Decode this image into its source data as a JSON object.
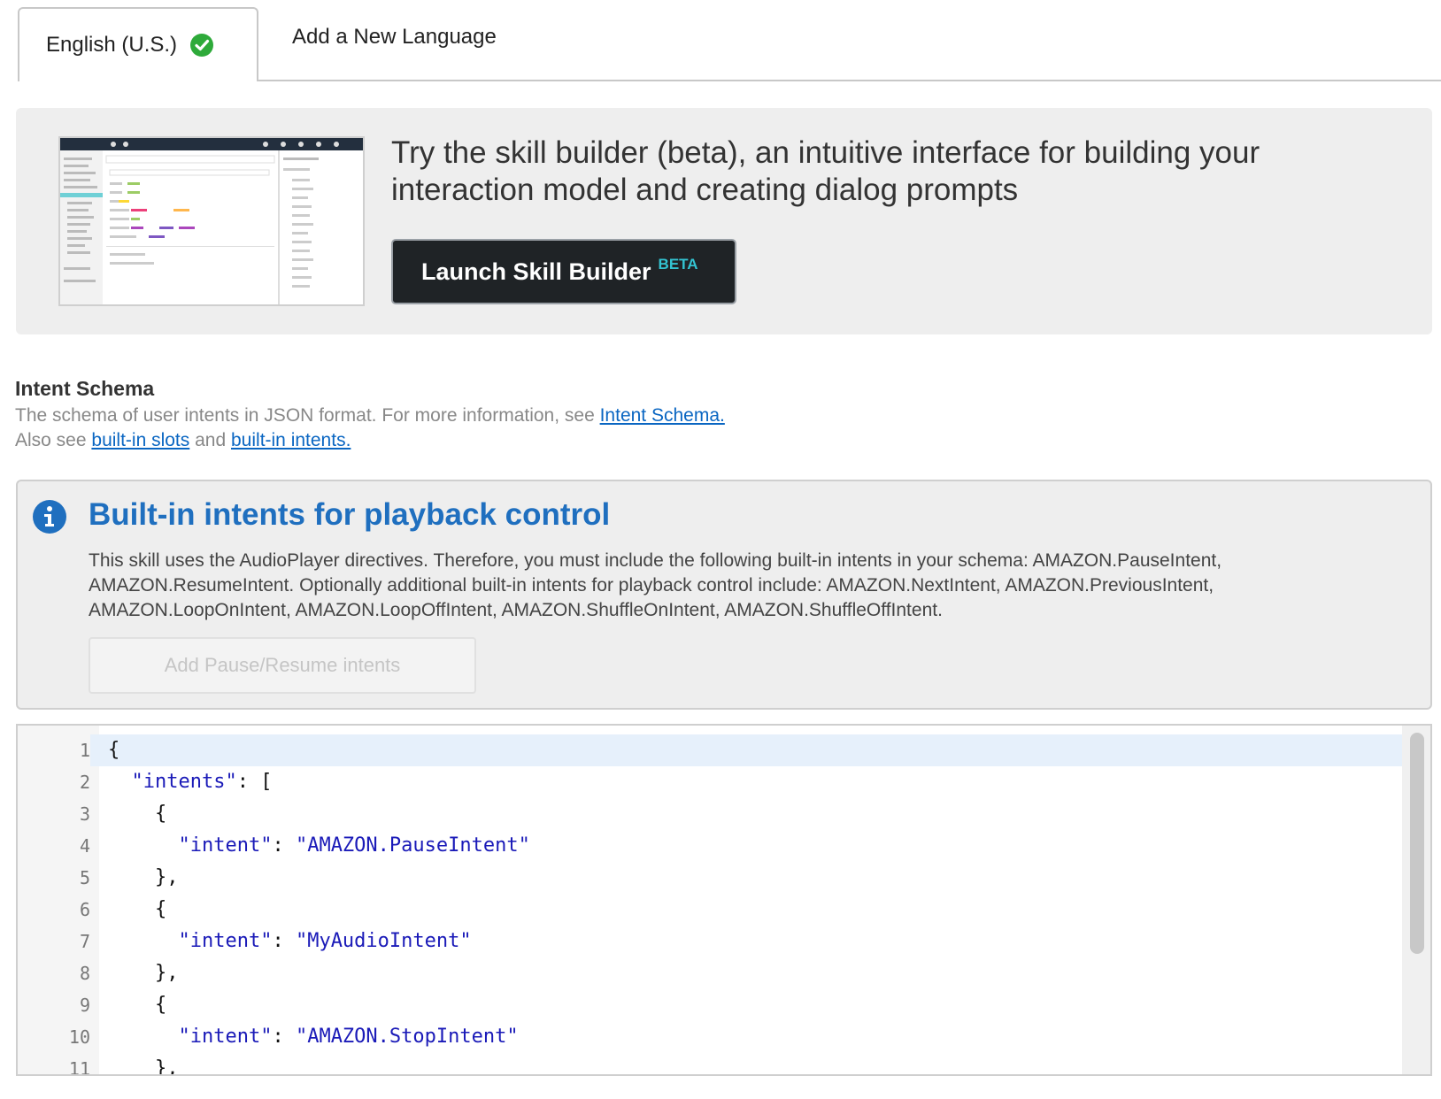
{
  "tabs": {
    "active_label": "English (U.S.)",
    "inactive_label": "Add a New Language"
  },
  "promo": {
    "text": "Try the skill builder (beta), an intuitive interface for building your interaction model and creating dialog prompts",
    "button_label": "Launch Skill Builder",
    "button_badge": "BETA"
  },
  "schema": {
    "title": "Intent Schema",
    "desc_prefix": "The schema of user intents in JSON format. For more information, see ",
    "desc_link": "Intent Schema.",
    "also_prefix": "Also see ",
    "slots_link": "built-in slots",
    "and_text": " and ",
    "intents_link": "built-in intents."
  },
  "info": {
    "title": "Built-in intents for playback control",
    "body": "This skill uses the AudioPlayer directives. Therefore, you must include the following built-in intents in your schema: AMAZON.PauseIntent, AMAZON.ResumeIntent. Optionally additional built-in intents for playback control include: AMAZON.NextIntent, AMAZON.PreviousIntent, AMAZON.LoopOnIntent, AMAZON.LoopOffIntent, AMAZON.ShuffleOnIntent, AMAZON.ShuffleOffIntent.",
    "button_label": "Add Pause/Resume intents"
  },
  "editor": {
    "line_numbers": [
      "1",
      "2",
      "3",
      "4",
      "5",
      "6",
      "7",
      "8",
      "9",
      "10",
      "11"
    ],
    "lines": [
      {
        "indent": "",
        "key": "",
        "rest": "{"
      },
      {
        "indent": "  ",
        "key": "\"intents\"",
        "rest": ": ["
      },
      {
        "indent": "    ",
        "key": "",
        "rest": "{"
      },
      {
        "indent": "      ",
        "key": "\"intent\"",
        "rest": ": ",
        "value": "\"AMAZON.PauseIntent\""
      },
      {
        "indent": "    ",
        "key": "",
        "rest": "},"
      },
      {
        "indent": "    ",
        "key": "",
        "rest": "{"
      },
      {
        "indent": "      ",
        "key": "\"intent\"",
        "rest": ": ",
        "value": "\"MyAudioIntent\""
      },
      {
        "indent": "    ",
        "key": "",
        "rest": "},"
      },
      {
        "indent": "    ",
        "key": "",
        "rest": "{"
      },
      {
        "indent": "      ",
        "key": "\"intent\"",
        "rest": ": ",
        "value": "\"AMAZON.StopIntent\""
      },
      {
        "indent": "    ",
        "key": "",
        "rest": "},"
      }
    ]
  },
  "colors": {
    "link": "#0a66c2",
    "info_title": "#1f6fbf",
    "check_green": "#2eaa3a",
    "beta_teal": "#33c3d1",
    "code_key": "#1a1ab8"
  },
  "icons": {
    "tab_check": "check-circle-icon",
    "info": "info-icon"
  }
}
